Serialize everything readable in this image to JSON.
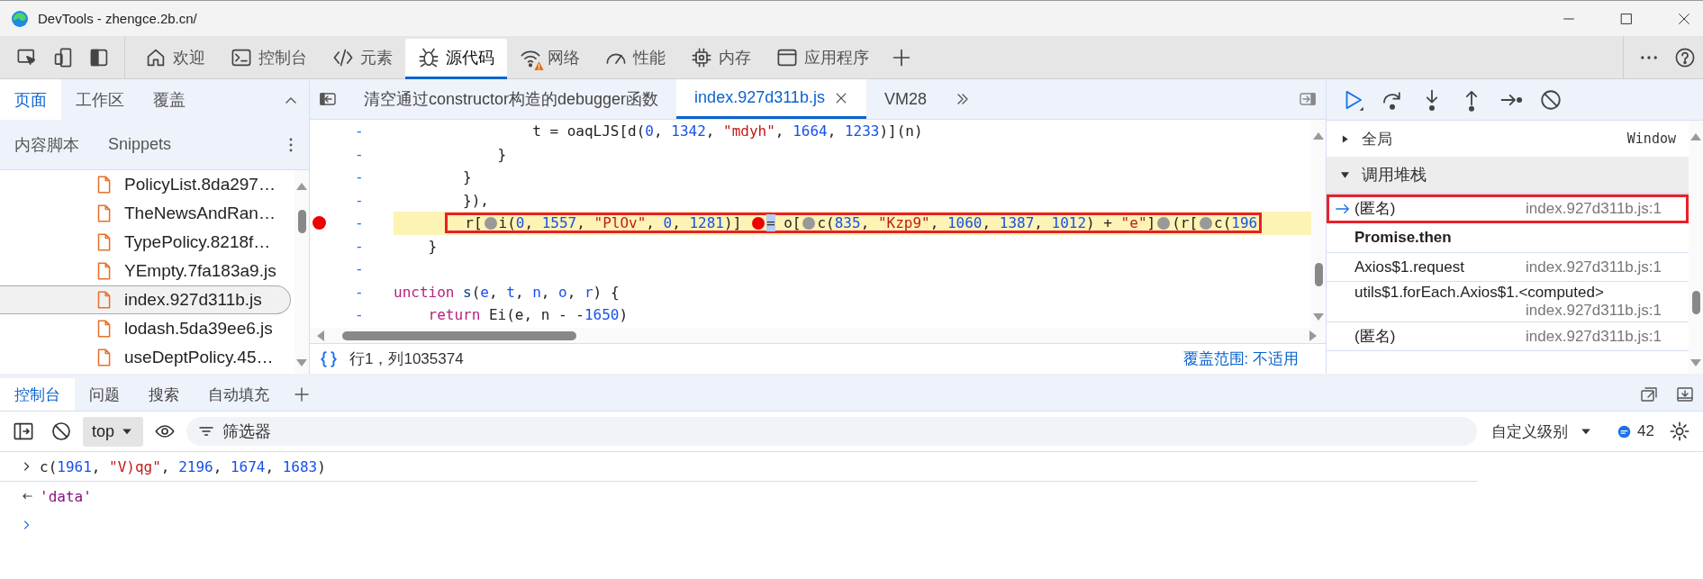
{
  "window": {
    "title": "DevTools - zhengce.2b.cn/"
  },
  "main_tabs": [
    {
      "label": "欢迎",
      "selected": false,
      "warning": false
    },
    {
      "label": "控制台",
      "selected": false,
      "warning": false
    },
    {
      "label": "元素",
      "selected": false,
      "warning": false
    },
    {
      "label": "源代码",
      "selected": true,
      "warning": false
    },
    {
      "label": "网络",
      "selected": false,
      "warning": true
    },
    {
      "label": "性能",
      "selected": false,
      "warning": false
    },
    {
      "label": "内存",
      "selected": false,
      "warning": false
    },
    {
      "label": "应用程序",
      "selected": false,
      "warning": false
    }
  ],
  "navigator": {
    "tabs": [
      {
        "label": "页面",
        "selected": true
      },
      {
        "label": "工作区",
        "selected": false
      },
      {
        "label": "覆盖",
        "selected": false
      }
    ],
    "more_tabs": [
      {
        "label": "内容脚本",
        "selected": false
      },
      {
        "label": "Snippets",
        "selected": false
      }
    ],
    "files": [
      {
        "name": "PolicyList.8da297…",
        "selected": false
      },
      {
        "name": "TheNewsAndRan…",
        "selected": false
      },
      {
        "name": "TypePolicy.8218f…",
        "selected": false
      },
      {
        "name": "YEmpty.7fa183a9.js",
        "selected": false
      },
      {
        "name": "index.927d311b.js",
        "selected": true
      },
      {
        "name": "lodash.5da39ee6.js",
        "selected": false
      },
      {
        "name": "useDeptPolicy.45…",
        "selected": false
      }
    ]
  },
  "editor": {
    "tabs": [
      {
        "label": "清空通过constructor构造的debugger函数",
        "selected": false,
        "closable": false
      },
      {
        "label": "index.927d311b.js",
        "selected": true,
        "closable": true
      },
      {
        "label": "VM28",
        "selected": false,
        "closable": false
      }
    ],
    "lines": [
      {
        "number": "-",
        "breakpoint": false,
        "paused": false,
        "annotated": false,
        "tokens": [
          {
            "t": "                t = oaqLJS[d(",
            "kind": "plain"
          },
          {
            "t": "0",
            "kind": "num"
          },
          {
            "t": ", ",
            "kind": "plain"
          },
          {
            "t": "1342",
            "kind": "num"
          },
          {
            "t": ", ",
            "kind": "plain"
          },
          {
            "t": "\"mdyh\"",
            "kind": "str"
          },
          {
            "t": ", ",
            "kind": "plain"
          },
          {
            "t": "1664",
            "kind": "num"
          },
          {
            "t": ", ",
            "kind": "plain"
          },
          {
            "t": "1233",
            "kind": "num"
          },
          {
            "t": ")](n)",
            "kind": "plain"
          }
        ]
      },
      {
        "number": "-",
        "breakpoint": false,
        "paused": false,
        "annotated": false,
        "tokens": [
          {
            "t": "            }",
            "kind": "plain"
          }
        ]
      },
      {
        "number": "-",
        "breakpoint": false,
        "paused": false,
        "annotated": false,
        "tokens": [
          {
            "t": "        }",
            "kind": "plain"
          }
        ]
      },
      {
        "number": "-",
        "breakpoint": false,
        "paused": false,
        "annotated": false,
        "tokens": [
          {
            "t": "        }),",
            "kind": "plain"
          }
        ]
      },
      {
        "number": "-",
        "breakpoint": true,
        "paused": true,
        "annotated": true,
        "tokens": [
          {
            "t": "  r[",
            "kind": "plain"
          },
          {
            "kind": "marker",
            "active": false
          },
          {
            "t": "i(",
            "kind": "plain"
          },
          {
            "t": "0",
            "kind": "num"
          },
          {
            "t": ", ",
            "kind": "plain"
          },
          {
            "t": "1557",
            "kind": "num"
          },
          {
            "t": ", ",
            "kind": "plain"
          },
          {
            "t": "\"PlOv\"",
            "kind": "str"
          },
          {
            "t": ", ",
            "kind": "plain"
          },
          {
            "t": "0",
            "kind": "num"
          },
          {
            "t": ", ",
            "kind": "plain"
          },
          {
            "t": "1281",
            "kind": "num"
          },
          {
            "t": ")] ",
            "kind": "plain"
          },
          {
            "kind": "marker",
            "active": true
          },
          {
            "t": "=",
            "kind": "sel"
          },
          {
            "t": " o[",
            "kind": "plain"
          },
          {
            "kind": "marker",
            "active": false
          },
          {
            "t": "c(",
            "kind": "plain"
          },
          {
            "t": "835",
            "kind": "num"
          },
          {
            "t": ", ",
            "kind": "plain"
          },
          {
            "t": "\"Kzp9\"",
            "kind": "str"
          },
          {
            "t": ", ",
            "kind": "plain"
          },
          {
            "t": "1060",
            "kind": "num"
          },
          {
            "t": ", ",
            "kind": "plain"
          },
          {
            "t": "1387",
            "kind": "num"
          },
          {
            "t": ", ",
            "kind": "plain"
          },
          {
            "t": "1012",
            "kind": "num"
          },
          {
            "t": ") + ",
            "kind": "plain"
          },
          {
            "t": "\"e\"",
            "kind": "str"
          },
          {
            "t": "]",
            "kind": "plain"
          },
          {
            "kind": "marker",
            "active": false
          },
          {
            "t": "(r[",
            "kind": "plain"
          },
          {
            "kind": "marker",
            "active": false
          },
          {
            "t": "c(",
            "kind": "plain"
          },
          {
            "t": "196",
            "kind": "num"
          }
        ]
      },
      {
        "number": "-",
        "breakpoint": false,
        "paused": false,
        "annotated": false,
        "tokens": [
          {
            "t": "    }",
            "kind": "plain"
          }
        ]
      },
      {
        "number": "-",
        "breakpoint": false,
        "paused": false,
        "annotated": false
      },
      {
        "number": "-",
        "breakpoint": false,
        "paused": false,
        "annotated": false,
        "tokens": [
          {
            "t": "unction",
            "kind": "kw"
          },
          {
            "t": " s",
            "kind": "def"
          },
          {
            "t": "(",
            "kind": "plain"
          },
          {
            "t": "e",
            "kind": "param"
          },
          {
            "t": ", ",
            "kind": "plain"
          },
          {
            "t": "t",
            "kind": "param"
          },
          {
            "t": ", ",
            "kind": "plain"
          },
          {
            "t": "n",
            "kind": "param"
          },
          {
            "t": ", ",
            "kind": "plain"
          },
          {
            "t": "o",
            "kind": "param"
          },
          {
            "t": ", ",
            "kind": "plain"
          },
          {
            "t": "r",
            "kind": "param"
          },
          {
            "t": ") {",
            "kind": "plain"
          }
        ]
      },
      {
        "number": "-",
        "breakpoint": false,
        "paused": false,
        "annotated": false,
        "tokens": [
          {
            "t": "    return",
            "kind": "kw"
          },
          {
            "t": " Ei(e, n - -",
            "kind": "plain"
          },
          {
            "t": "1650",
            "kind": "num"
          },
          {
            "t": ")",
            "kind": "plain"
          }
        ]
      }
    ],
    "status": {
      "position": "行1，列1035374",
      "coverage": "覆盖范围: 不适用"
    }
  },
  "debugger": {
    "scope": [
      {
        "label": "全局",
        "value": "Window",
        "expanded": false
      }
    ],
    "call_stack": {
      "title": "调用堆栈",
      "expanded": true,
      "frames": [
        {
          "kind": "frame",
          "name": "(匿名)",
          "location": "index.927d311b.js:1",
          "selected": true,
          "annotated": true
        },
        {
          "kind": "async",
          "name": "Promise.then"
        },
        {
          "kind": "frame",
          "name": "Axios$1.request",
          "location": "index.927d311b.js:1",
          "selected": false,
          "annotated": false
        },
        {
          "kind": "frame",
          "name": "utils$1.forEach.Axios$1.<computed>",
          "location": "index.927d311b.js:1",
          "selected": false,
          "annotated": false
        },
        {
          "kind": "frame",
          "name": "(匿名)",
          "location": "index.927d311b.js:1",
          "selected": false,
          "annotated": false
        }
      ]
    }
  },
  "drawer": {
    "tabs": [
      {
        "label": "控制台",
        "selected": true
      },
      {
        "label": "问题",
        "selected": false
      },
      {
        "label": "搜索",
        "selected": false
      },
      {
        "label": "自动填充",
        "selected": false
      }
    ],
    "context": "top",
    "filter": {
      "placeholder": "筛选器"
    },
    "levels": "自定义级别",
    "message_count": "42",
    "console": [
      {
        "kind": "input",
        "tokens": [
          {
            "t": "c(",
            "kind": "plain"
          },
          {
            "t": "1961",
            "kind": "num"
          },
          {
            "t": ", ",
            "kind": "plain"
          },
          {
            "t": "\"V)qg\"",
            "kind": "str"
          },
          {
            "t": ", ",
            "kind": "plain"
          },
          {
            "t": "2196",
            "kind": "num"
          },
          {
            "t": ", ",
            "kind": "plain"
          },
          {
            "t": "1674",
            "kind": "num"
          },
          {
            "t": ", ",
            "kind": "plain"
          },
          {
            "t": "1683",
            "kind": "num"
          },
          {
            "t": ")",
            "kind": "plain"
          }
        ]
      },
      {
        "kind": "result",
        "tokens": [
          {
            "t": "'data'",
            "kind": "str2"
          }
        ]
      },
      {
        "kind": "prompt"
      }
    ]
  }
}
